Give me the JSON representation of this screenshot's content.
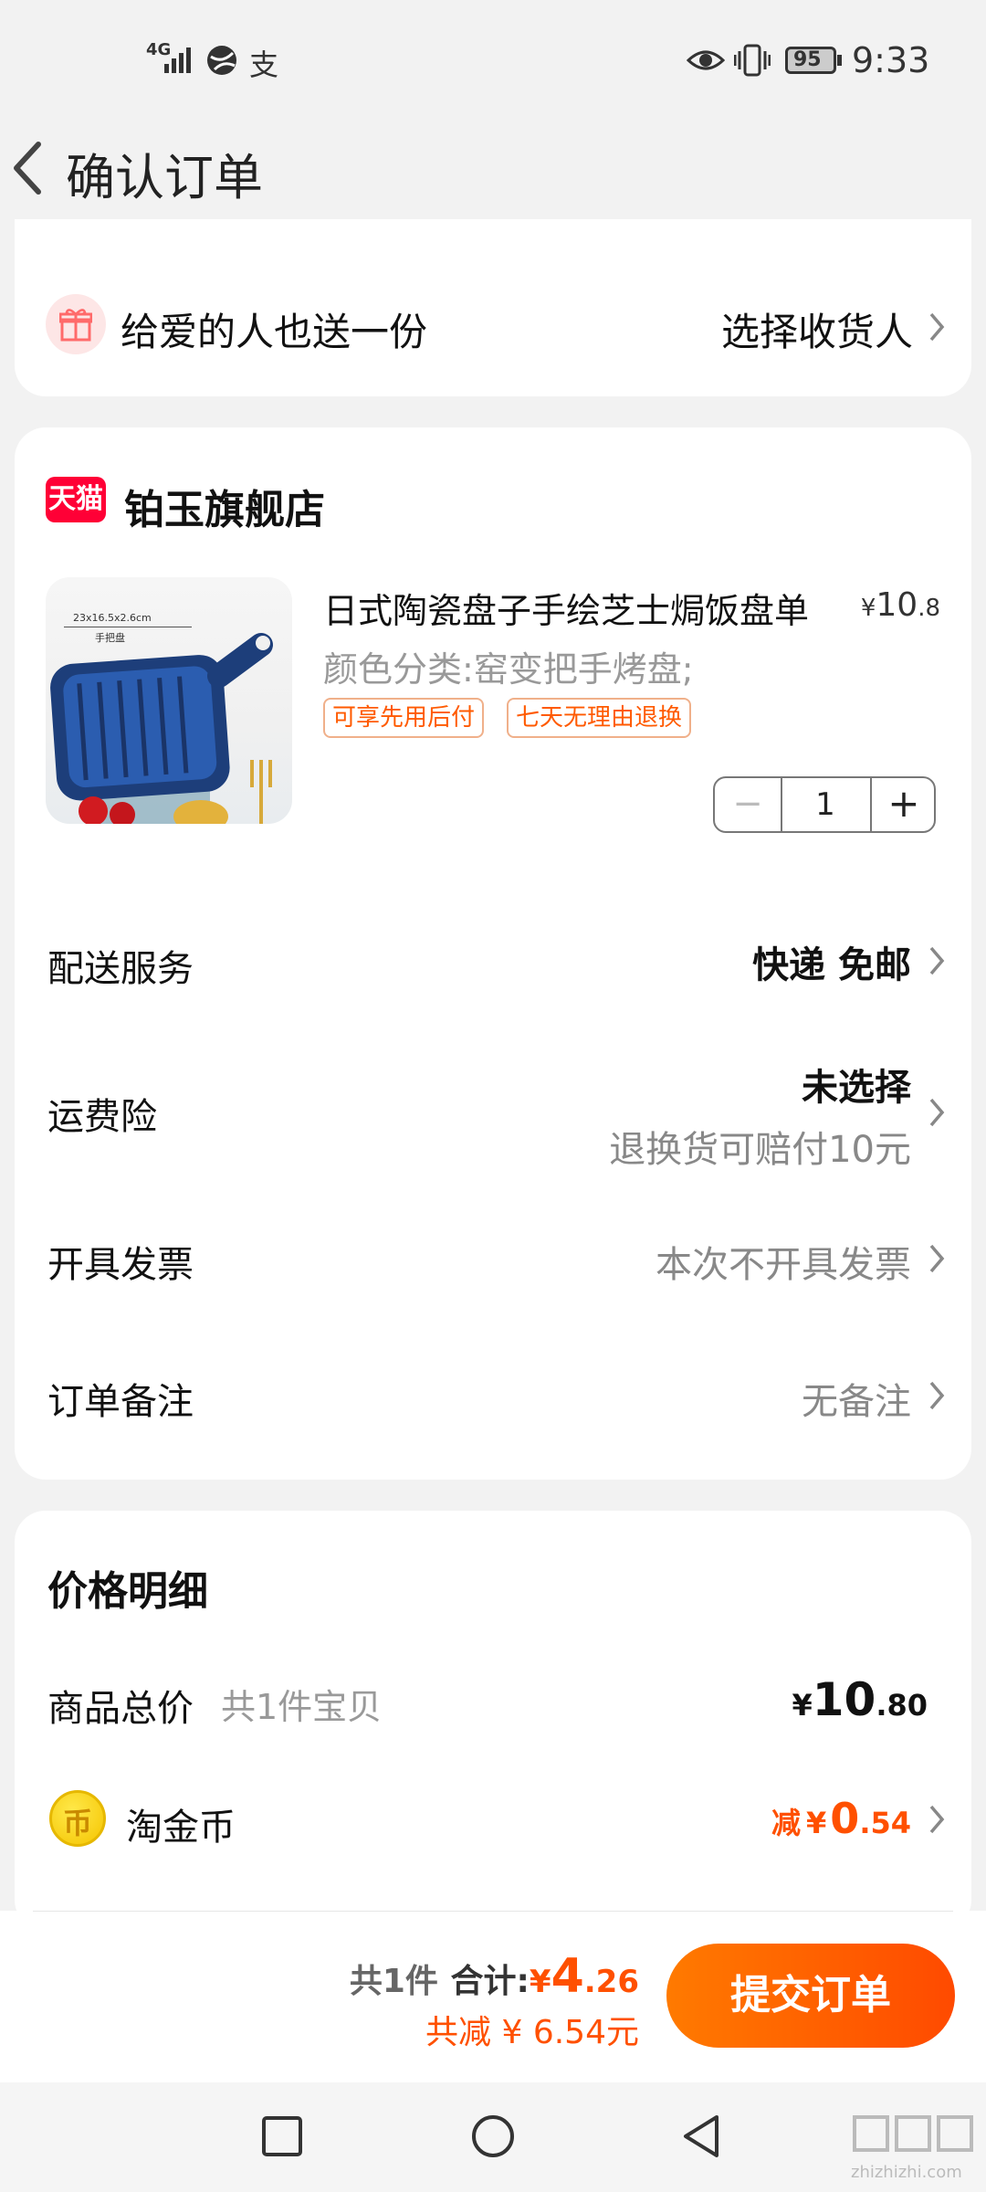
{
  "status_bar": {
    "network": "4G",
    "pay_icon_text": "支",
    "battery": "95",
    "time": "9:33"
  },
  "header": {
    "title": "确认订单"
  },
  "gift": {
    "label": "给爱的人也送一份",
    "action": "选择收货人"
  },
  "store": {
    "badge": "天猫",
    "name": "铂玉旗舰店"
  },
  "product": {
    "image_label_size": "23x16.5x2.6cm",
    "image_label_name": "手把盘",
    "title": "日式陶瓷盘子手绘芝士焗饭盘单",
    "price_currency": "¥",
    "price_int": "10",
    "price_dec": ".8",
    "spec": "颜色分类:窑变把手烤盘;",
    "tags": [
      "可享先用后付",
      "七天无理由退换"
    ],
    "quantity": "1",
    "minus": "−",
    "plus": "+"
  },
  "rows": {
    "delivery_label": "配送服务",
    "delivery_value": "快递 免邮",
    "insurance_label": "运费险",
    "insurance_value": "未选择",
    "insurance_sub": "退换货可赔付10元",
    "invoice_label": "开具发票",
    "invoice_value": "本次不开具发票",
    "note_label": "订单备注",
    "note_value": "无备注"
  },
  "price_detail": {
    "title": "价格明细",
    "goods_label": "商品总价",
    "goods_count": "共1件宝贝",
    "goods_currency": "¥",
    "goods_int": "10",
    "goods_dec": ".80",
    "coin_icon": "币",
    "coin_label": "淘金币",
    "coin_prefix": "减",
    "coin_currency": "¥",
    "coin_int": "0",
    "coin_dec": ".54"
  },
  "bottom_bar": {
    "count": "共1件",
    "total_label": "合计:",
    "total_currency": "¥",
    "total_int": "4",
    "total_dec": ".26",
    "saved": "共减 ¥ 6.54元",
    "submit": "提交订单"
  },
  "watermark": {
    "text": "zhizhizhi.com"
  },
  "colors": {
    "accent": "#ff5000",
    "gray": "#888888",
    "background": "#f2f2f2"
  }
}
